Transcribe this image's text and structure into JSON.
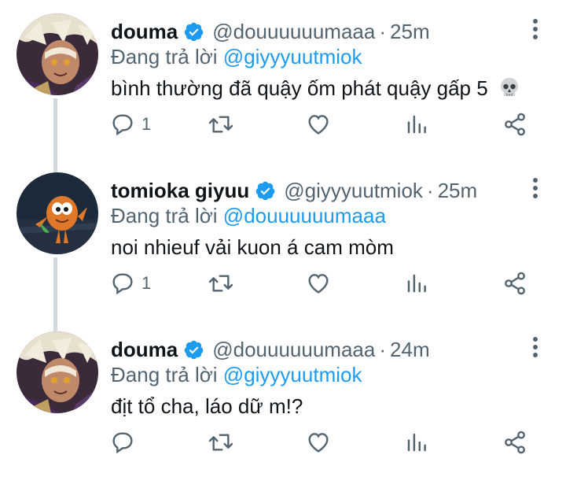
{
  "tweets": [
    {
      "name": "douma",
      "handle": "@douuuuuumaaa",
      "separator": "·",
      "time": "25m",
      "reply_prefix": "Đang trả lời",
      "reply_to": "@giyyyuutmiok",
      "text": "bình thường đã quậy ốm phát quậy gấp 5",
      "emoji_icon": "skull-emoji",
      "reply_count": "1"
    },
    {
      "name": "tomioka giyuu",
      "handle": "@giyyyuutmiok",
      "separator": "·",
      "time": "25m",
      "reply_prefix": "Đang trả lời",
      "reply_to": "@douuuuuumaaa",
      "text": "noi nhieuf vải kuon á cam mòm",
      "reply_count": "1"
    },
    {
      "name": "douma",
      "handle": "@douuuuuumaaa",
      "separator": "·",
      "time": "24m",
      "reply_prefix": "Đang trả lời",
      "reply_to": "@giyyyuutmiok",
      "text": "địt tổ cha, láo dữ m!?",
      "reply_count": ""
    }
  ],
  "colors": {
    "accent": "#1d9bf0",
    "secondary_text": "#536471",
    "thread_line": "#cfd9de",
    "icon": "#536471"
  },
  "icons": [
    "verified-badge-icon",
    "more-options-icon",
    "reply-icon",
    "retweet-icon",
    "like-icon",
    "analytics-icon",
    "share-icon",
    "skull-emoji"
  ]
}
